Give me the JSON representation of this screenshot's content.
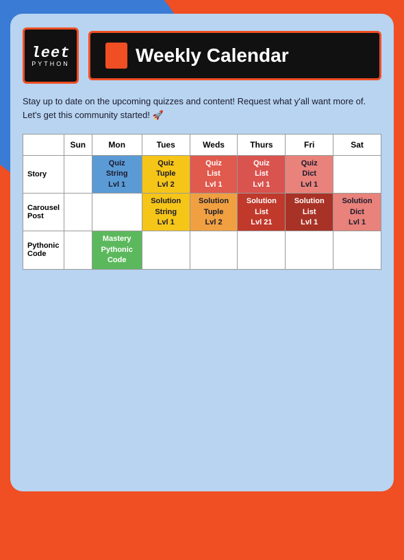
{
  "app": {
    "logo_leet": "leet",
    "logo_python": "python",
    "title": "Weekly Calendar",
    "subtitle": "Stay up to date on the upcoming quizzes and content! Request what y'all want more of. Let's get this community started! 🚀"
  },
  "table": {
    "col_headers": [
      "",
      "Sun",
      "Mon",
      "Tues",
      "Weds",
      "Thurs",
      "Fri",
      "Sat"
    ],
    "rows": [
      {
        "label": "Story",
        "cells": [
          {
            "type": "empty",
            "text": ""
          },
          {
            "type": "quiz-blue",
            "line1": "Quiz",
            "line2": "String",
            "line3": "Lvl 1"
          },
          {
            "type": "quiz-yellow",
            "line1": "Quiz",
            "line2": "Tuple",
            "line3": "Lvl 2"
          },
          {
            "type": "quiz-red",
            "line1": "Quiz",
            "line2": "List",
            "line3": "Lvl 1"
          },
          {
            "type": "quiz-pink",
            "line1": "Quiz",
            "line2": "List",
            "line3": "Lvl 1"
          },
          {
            "type": "quiz-salmon",
            "line1": "Quiz",
            "line2": "Dict",
            "line3": "Lvl 1"
          },
          {
            "type": "empty",
            "text": ""
          }
        ]
      },
      {
        "label": "Carousel Post",
        "cells": [
          {
            "type": "empty",
            "text": ""
          },
          {
            "type": "empty",
            "text": ""
          },
          {
            "type": "sol-yellow",
            "line1": "Solution",
            "line2": "String",
            "line3": "Lvl 1"
          },
          {
            "type": "sol-orange",
            "line1": "Solution",
            "line2": "Tuple",
            "line3": "Lvl 2"
          },
          {
            "type": "sol-red",
            "line1": "Solution",
            "line2": "List",
            "line3": "Lvl 21"
          },
          {
            "type": "sol-darkred",
            "line1": "Solution",
            "line2": "List",
            "line3": "Lvl 1"
          },
          {
            "type": "sol-salmon",
            "line1": "Solution",
            "line2": "Dict",
            "line3": "Lvl 1"
          }
        ]
      },
      {
        "label": "Pythonic Code",
        "cells": [
          {
            "type": "empty",
            "text": ""
          },
          {
            "type": "mastery",
            "line1": "Mastery",
            "line2": "Pythonic",
            "line3": "Code"
          },
          {
            "type": "empty",
            "text": ""
          },
          {
            "type": "empty",
            "text": ""
          },
          {
            "type": "empty",
            "text": ""
          },
          {
            "type": "empty",
            "text": ""
          },
          {
            "type": "empty",
            "text": ""
          }
        ]
      }
    ]
  }
}
